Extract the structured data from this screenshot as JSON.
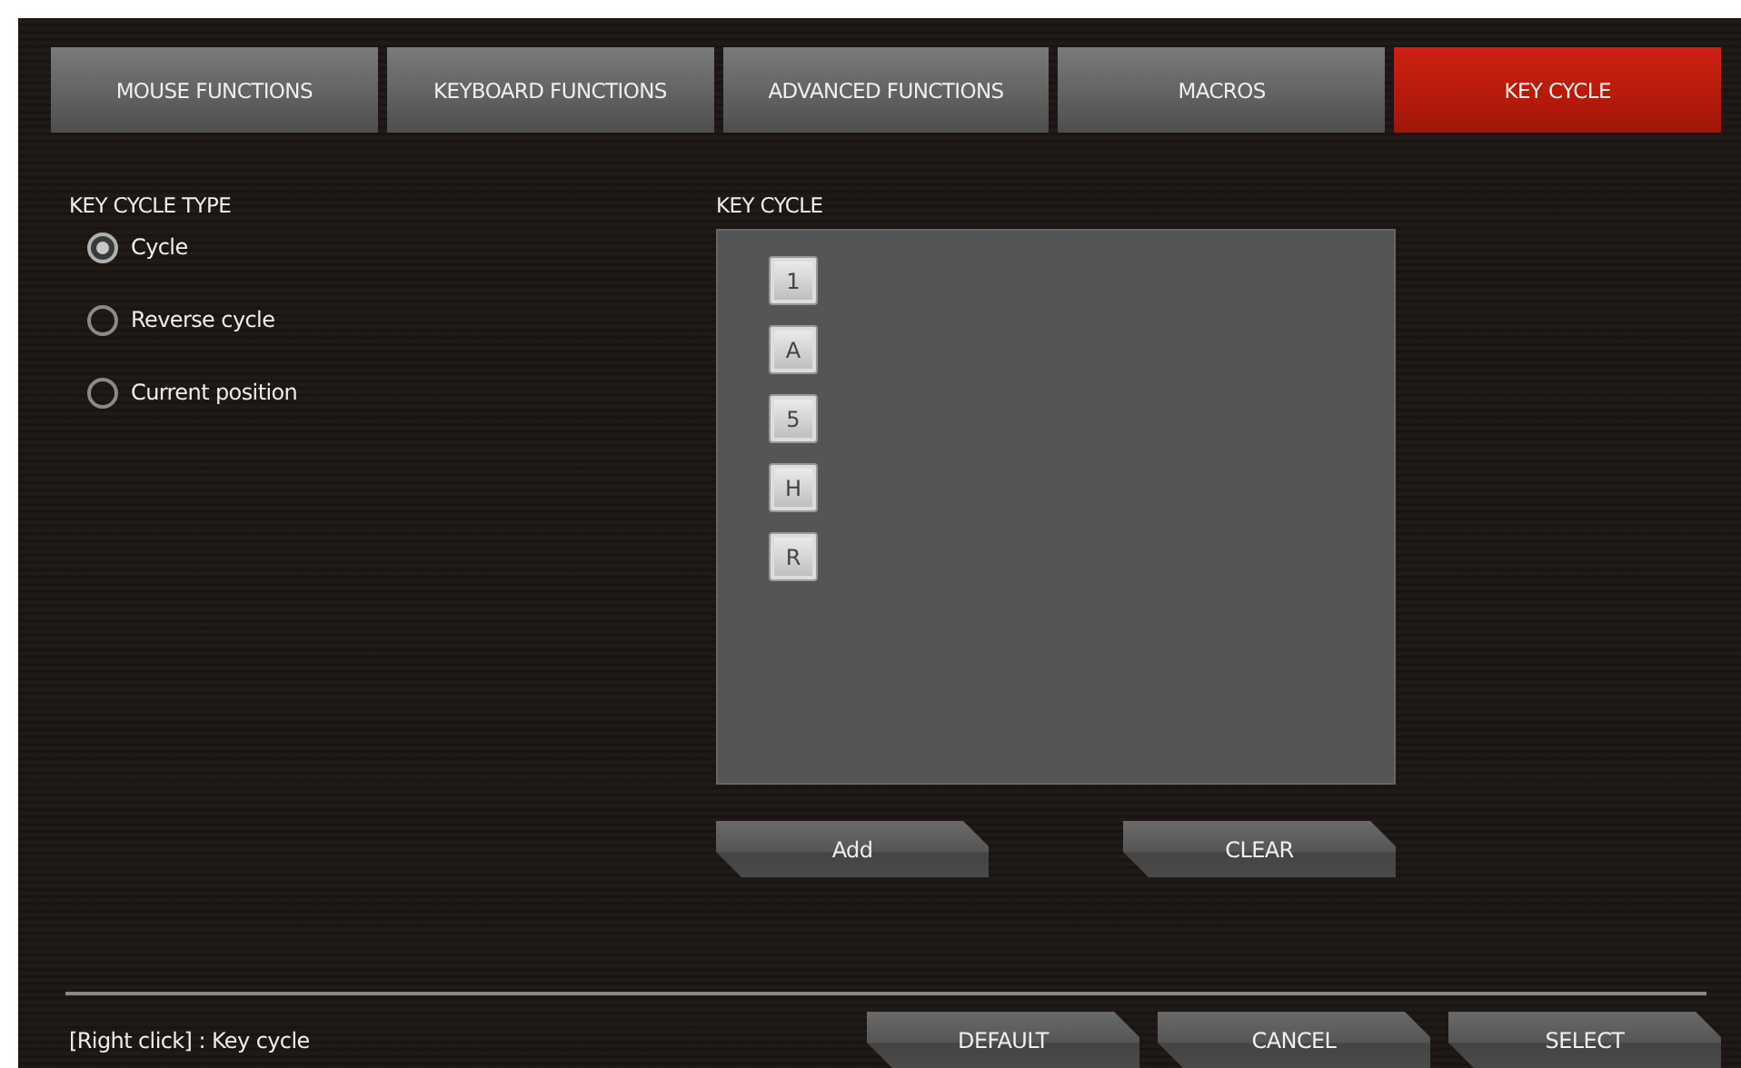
{
  "tabs": [
    {
      "label": "MOUSE FUNCTIONS",
      "selected": false
    },
    {
      "label": "KEYBOARD FUNCTIONS",
      "selected": false
    },
    {
      "label": "ADVANCED FUNCTIONS",
      "selected": false
    },
    {
      "label": "MACROS",
      "selected": false
    },
    {
      "label": "KEY CYCLE",
      "selected": true
    }
  ],
  "key_cycle_type": {
    "heading": "KEY CYCLE TYPE",
    "options": [
      {
        "label": "Cycle",
        "selected": true
      },
      {
        "label": "Reverse cycle",
        "selected": false
      },
      {
        "label": "Current position",
        "selected": false
      }
    ]
  },
  "key_cycle": {
    "heading": "KEY CYCLE",
    "keys": [
      "1",
      "A",
      "5",
      "H",
      "R"
    ],
    "buttons": [
      "Add",
      "CLEAR"
    ]
  },
  "footer": {
    "hint": "[Right click] : Key cycle",
    "buttons": [
      "DEFAULT",
      "CANCEL",
      "SELECT"
    ]
  }
}
